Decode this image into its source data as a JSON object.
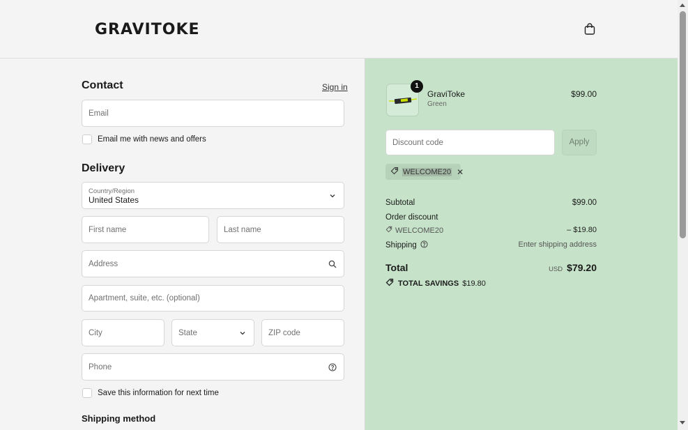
{
  "header": {
    "logo": "GRAVITOKE",
    "cart_icon": "shopping-bag-icon"
  },
  "contact": {
    "title": "Contact",
    "sign_in": "Sign in",
    "email_placeholder": "Email",
    "newsletter_label": "Email me with news and offers"
  },
  "delivery": {
    "title": "Delivery",
    "country_label": "Country/Region",
    "country_value": "United States",
    "first_name": "First name",
    "last_name": "Last name",
    "address": "Address",
    "apartment": "Apartment, suite, etc. (optional)",
    "city": "City",
    "state": "State",
    "zip": "ZIP code",
    "phone": "Phone",
    "save_info": "Save this information for next time"
  },
  "shipping_method": {
    "title": "Shipping method"
  },
  "summary": {
    "product": {
      "name": "GraviToke",
      "variant": "Green",
      "price": "$99.00",
      "quantity": "1"
    },
    "discount_placeholder": "Discount code",
    "apply_label": "Apply",
    "applied_code": "WELCOME20",
    "subtotal_label": "Subtotal",
    "subtotal_value": "$99.00",
    "order_discount_label": "Order discount",
    "order_discount_code": "WELCOME20",
    "order_discount_value": "– $19.80",
    "shipping_label": "Shipping",
    "shipping_value": "Enter shipping address",
    "total_label": "Total",
    "currency": "USD",
    "total_value": "$79.20",
    "savings_label": "TOTAL SAVINGS",
    "savings_value": "$19.80"
  },
  "colors": {
    "summary_bg": "#c6e3c9",
    "page_bg": "#f4f4f4"
  }
}
